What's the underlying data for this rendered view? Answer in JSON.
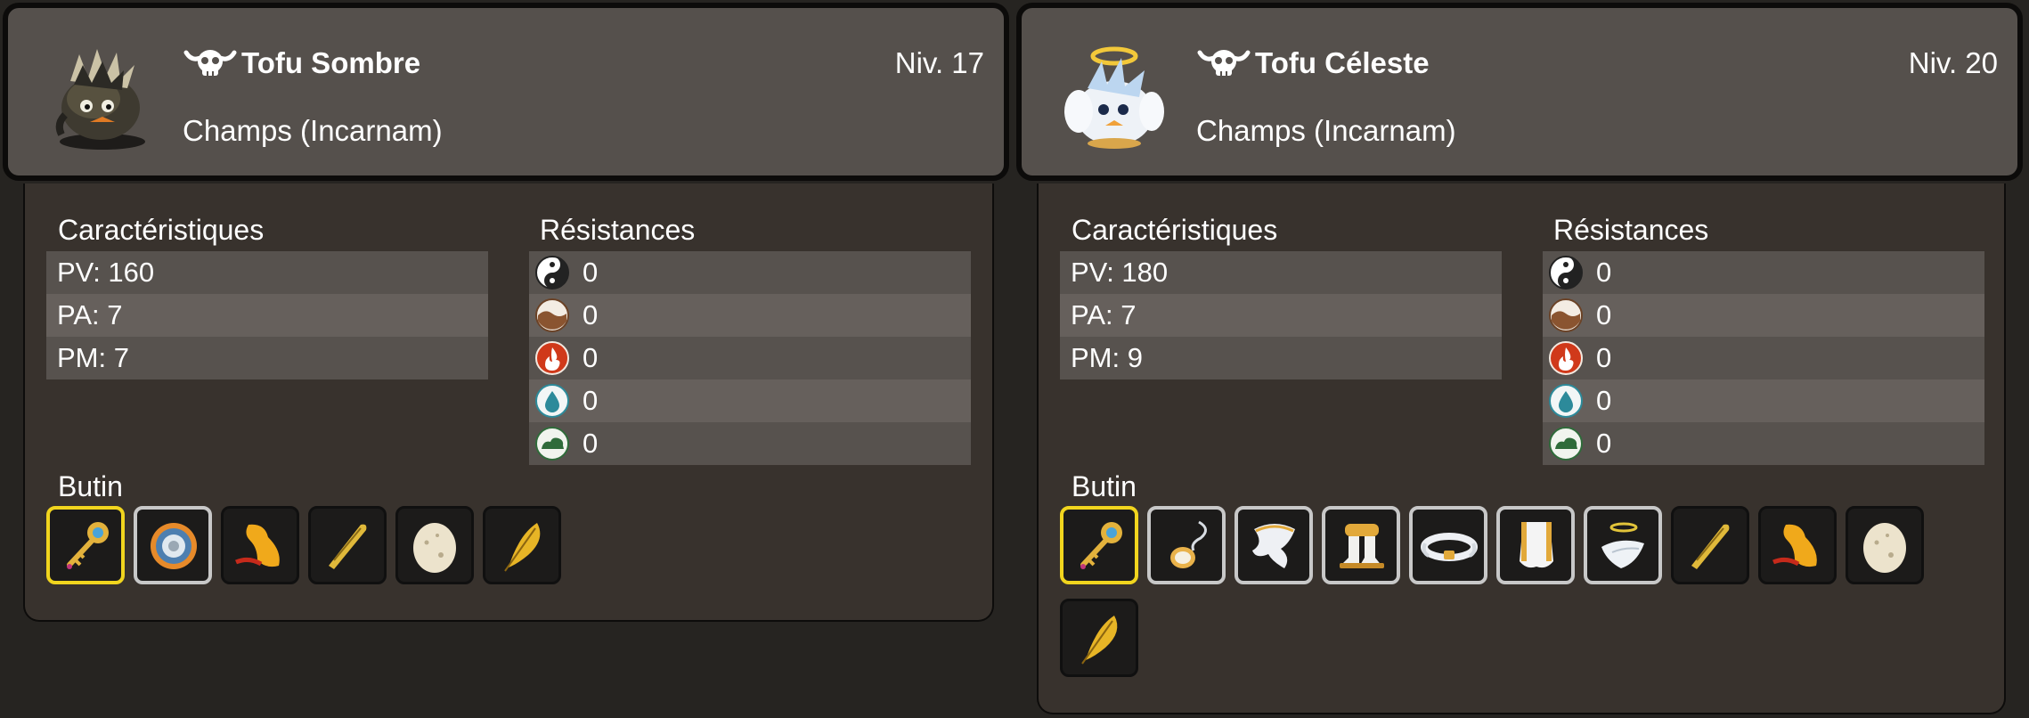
{
  "monsters": [
    {
      "name": "Tofu Sombre",
      "level": "Niv. 17",
      "location": "Champs (Incarnam)",
      "portrait_icon": "dark-tofu-portrait",
      "stats_title": "Caractéristiques",
      "stats": [
        "PV: 160",
        "PA: 7",
        "PM: 7"
      ],
      "resist_title": "Résistances",
      "resistances": [
        {
          "icon": "neutral-icon",
          "value": "0"
        },
        {
          "icon": "earth-icon",
          "value": "0"
        },
        {
          "icon": "fire-icon",
          "value": "0"
        },
        {
          "icon": "water-icon",
          "value": "0"
        },
        {
          "icon": "air-icon",
          "value": "0"
        }
      ],
      "loot_title": "Butin",
      "loot": [
        {
          "icon": "key-icon",
          "frame": "gold"
        },
        {
          "icon": "ring-icon",
          "frame": "silver"
        },
        {
          "icon": "orange-plume-icon",
          "frame": "none"
        },
        {
          "icon": "beak-icon",
          "frame": "none"
        },
        {
          "icon": "egg-icon",
          "frame": "none"
        },
        {
          "icon": "golden-feather-icon",
          "frame": "none"
        }
      ]
    },
    {
      "name": "Tofu Céleste",
      "level": "Niv. 20",
      "location": "Champs (Incarnam)",
      "portrait_icon": "celestial-tofu-portrait",
      "stats_title": "Caractéristiques",
      "stats": [
        "PV: 180",
        "PA: 7",
        "PM: 9"
      ],
      "resist_title": "Résistances",
      "resistances": [
        {
          "icon": "neutral-icon",
          "value": "0"
        },
        {
          "icon": "earth-icon",
          "value": "0"
        },
        {
          "icon": "fire-icon",
          "value": "0"
        },
        {
          "icon": "water-icon",
          "value": "0"
        },
        {
          "icon": "air-icon",
          "value": "0"
        }
      ],
      "loot_title": "Butin",
      "loot": [
        {
          "icon": "key-icon",
          "frame": "gold"
        },
        {
          "icon": "amulet-icon",
          "frame": "silver"
        },
        {
          "icon": "cape-icon",
          "frame": "silver"
        },
        {
          "icon": "boots-icon",
          "frame": "silver"
        },
        {
          "icon": "belt-icon",
          "frame": "silver"
        },
        {
          "icon": "wing-cape-icon",
          "frame": "silver"
        },
        {
          "icon": "halo-hat-icon",
          "frame": "silver"
        },
        {
          "icon": "beak-icon",
          "frame": "none"
        },
        {
          "icon": "orange-plume-icon",
          "frame": "none"
        },
        {
          "icon": "egg-icon",
          "frame": "none"
        },
        {
          "icon": "golden-feather-icon",
          "frame": "none"
        }
      ]
    }
  ],
  "colors": {
    "background": "#262421",
    "header": "#55504c",
    "panel": "#38322d",
    "row_a": "#57524e",
    "row_b": "#66605c",
    "gold_frame": "#f1d51e",
    "silver_frame": "#c8c8c8"
  }
}
